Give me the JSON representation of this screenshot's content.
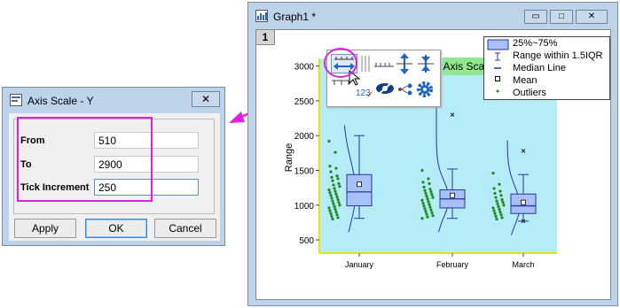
{
  "dialog": {
    "title": "Axis Scale - Y",
    "close_glyph": "✕",
    "fields": [
      {
        "label": "From",
        "value": "510"
      },
      {
        "label": "To",
        "value": "2900"
      },
      {
        "label": "Tick Increment",
        "value": "250"
      }
    ],
    "buttons": {
      "apply": "Apply",
      "ok": "OK",
      "cancel": "Cancel"
    }
  },
  "graph_window": {
    "title": "Graph1 *",
    "layer_number": "1",
    "controls": {
      "minimize": "▭",
      "maximize": "□",
      "close": "✕"
    }
  },
  "toolbar": {
    "hover_label": "Axis Scale",
    "tick_label_sample": "123"
  },
  "legend": {
    "items": [
      {
        "label": "25%~75%"
      },
      {
        "label": "Range within 1.5IQR"
      },
      {
        "label": "Median Line"
      },
      {
        "label": "Mean"
      },
      {
        "label": "Outliers"
      }
    ]
  },
  "colors": {
    "plot_bg": "#b6ecf8",
    "box_fill": "#a8c0f5",
    "box_stroke": "#2636a0",
    "scatter": "#1a8a1a",
    "highlight": "#e020e0",
    "axis": "#e6e600"
  },
  "chart_data": {
    "type": "box",
    "title": "",
    "xlabel": "",
    "ylabel": "Range",
    "categories": [
      "January",
      "February",
      "March"
    ],
    "yticks": [
      500,
      1000,
      1500,
      2000,
      2500,
      3000
    ],
    "ytick_labels": [
      "500",
      "1000",
      "1500",
      "2000",
      "2500",
      "3000"
    ],
    "ylim": [
      310,
      3110
    ],
    "boxes": [
      {
        "category": "January",
        "q1": 990,
        "median": 1190,
        "q3": 1440,
        "whisker_low": 810,
        "whisker_high": 2000,
        "mean": 1300,
        "outliers": []
      },
      {
        "category": "February",
        "q1": 960,
        "median": 1090,
        "q3": 1220,
        "whisker_low": 810,
        "whisker_high": 1520,
        "mean": 1140,
        "outliers": [
          2300
        ]
      },
      {
        "category": "March",
        "q1": 880,
        "median": 990,
        "q3": 1160,
        "whisker_low": 770,
        "whisker_high": 1440,
        "mean": 1040,
        "outliers": [
          1780,
          770
        ]
      }
    ],
    "scatter": [
      {
        "category": "January",
        "values": [
          1920,
          1760,
          1560,
          1530,
          1480,
          1420,
          1400,
          1380,
          1350,
          1310,
          1290,
          1270,
          1240,
          1220,
          1200,
          1180,
          1160,
          1140,
          1120,
          1100,
          1080,
          1060,
          1040,
          1020,
          1000,
          980,
          960,
          940,
          920,
          900,
          880,
          860,
          840,
          820,
          800
        ]
      },
      {
        "category": "February",
        "values": [
          1500,
          1380,
          1330,
          1310,
          1260,
          1230,
          1210,
          1190,
          1170,
          1150,
          1130,
          1110,
          1090,
          1070,
          1050,
          1030,
          1010,
          990,
          970,
          950,
          930,
          910,
          890,
          870,
          850,
          830,
          810
        ]
      },
      {
        "category": "March",
        "values": [
          1460,
          1300,
          1240,
          1200,
          1170,
          1140,
          1110,
          1080,
          1060,
          1040,
          1020,
          1000,
          980,
          960,
          940,
          920,
          900,
          880,
          860,
          840,
          820,
          800
        ]
      }
    ]
  }
}
